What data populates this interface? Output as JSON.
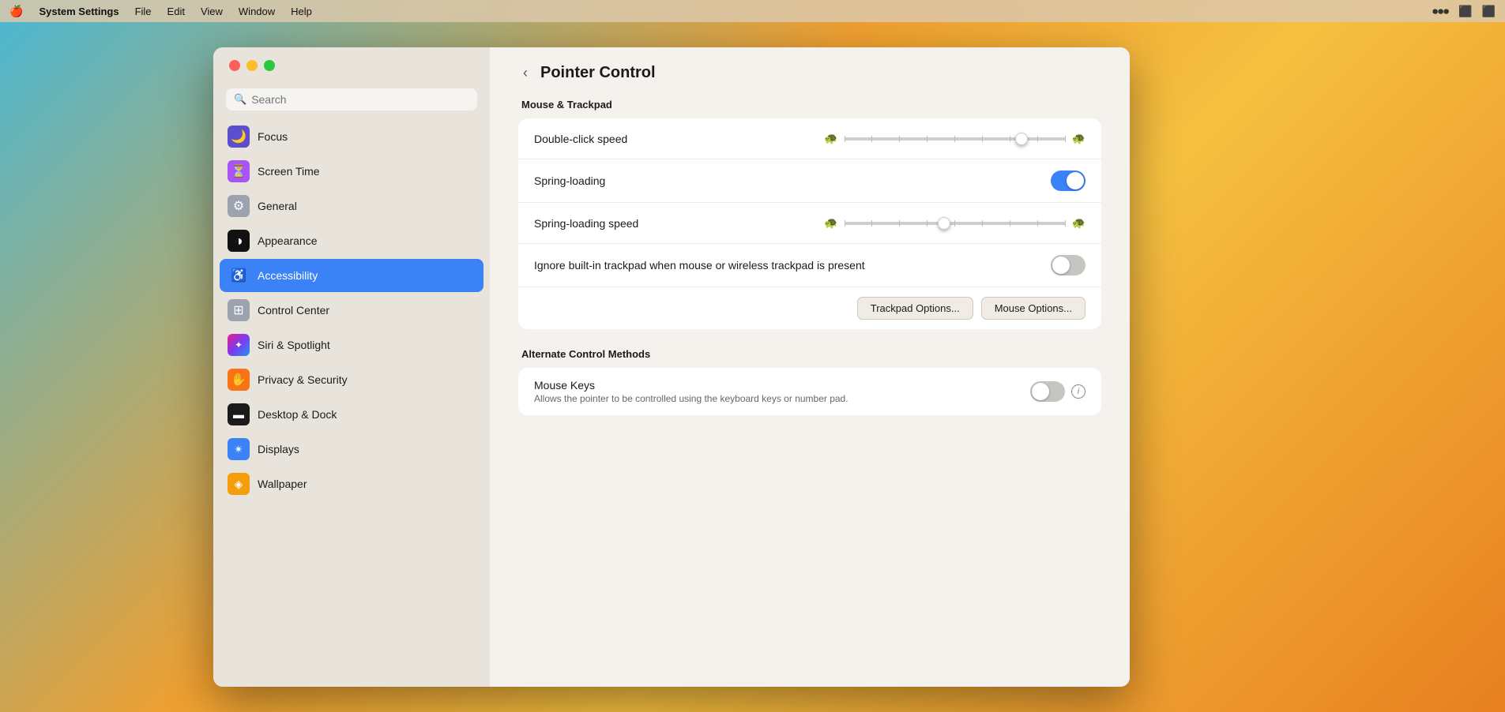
{
  "menubar": {
    "apple_symbol": "🍎",
    "app_name": "System Settings",
    "menu_items": [
      "File",
      "Edit",
      "View",
      "Window",
      "Help"
    ],
    "right_icons": [
      "⏺",
      "⬛",
      "⬛"
    ]
  },
  "sidebar": {
    "search_placeholder": "Search",
    "items": [
      {
        "id": "focus",
        "label": "Focus",
        "icon": "🌙",
        "icon_class": "icon-focus"
      },
      {
        "id": "screen-time",
        "label": "Screen Time",
        "icon": "⏳",
        "icon_class": "icon-screentime"
      },
      {
        "id": "general",
        "label": "General",
        "icon": "⚙",
        "icon_class": "icon-general"
      },
      {
        "id": "appearance",
        "label": "Appearance",
        "icon": "◑",
        "icon_class": "icon-appearance"
      },
      {
        "id": "accessibility",
        "label": "Accessibility",
        "icon": "♿",
        "icon_class": "icon-accessibility",
        "active": true
      },
      {
        "id": "control-center",
        "label": "Control Center",
        "icon": "⊞",
        "icon_class": "icon-controlcenter"
      },
      {
        "id": "siri-spotlight",
        "label": "Siri & Spotlight",
        "icon": "✦",
        "icon_class": "icon-siri"
      },
      {
        "id": "privacy-security",
        "label": "Privacy & Security",
        "icon": "✋",
        "icon_class": "icon-privacy"
      },
      {
        "id": "desktop-dock",
        "label": "Desktop & Dock",
        "icon": "▬",
        "icon_class": "icon-desktop"
      },
      {
        "id": "displays",
        "label": "Displays",
        "icon": "✴",
        "icon_class": "icon-displays"
      },
      {
        "id": "wallpaper",
        "label": "Wallpaper",
        "icon": "◈",
        "icon_class": "icon-wallpaper"
      }
    ]
  },
  "content": {
    "back_label": "‹",
    "page_title": "Pointer Control",
    "sections": {
      "mouse_trackpad": {
        "title": "Mouse & Trackpad",
        "rows": [
          {
            "id": "double-click-speed",
            "label": "Double-click speed",
            "control": "slider",
            "value": 0.8
          },
          {
            "id": "spring-loading",
            "label": "Spring-loading",
            "control": "toggle",
            "enabled": true
          },
          {
            "id": "spring-loading-speed",
            "label": "Spring-loading speed",
            "control": "slider",
            "value": 0.45
          },
          {
            "id": "ignore-trackpad",
            "label": "Ignore built-in trackpad when mouse or wireless trackpad is present",
            "control": "toggle",
            "enabled": false
          }
        ],
        "buttons": [
          {
            "id": "trackpad-options",
            "label": "Trackpad Options..."
          },
          {
            "id": "mouse-options",
            "label": "Mouse Options..."
          }
        ]
      },
      "alternate_control": {
        "title": "Alternate Control Methods",
        "rows": [
          {
            "id": "mouse-keys",
            "label": "Mouse Keys",
            "sublabel": "Allows the pointer to be controlled using the keyboard keys or number pad.",
            "control": "toggle-info",
            "enabled": false
          }
        ]
      }
    }
  }
}
